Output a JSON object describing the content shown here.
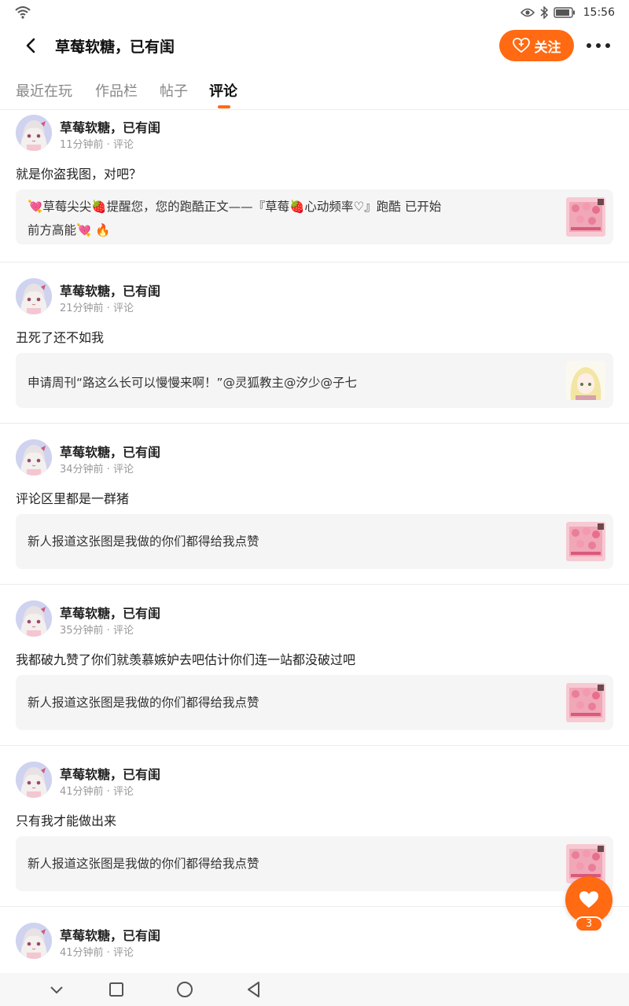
{
  "status": {
    "time": "15:56"
  },
  "header": {
    "title": "草莓软糖，已有闺",
    "follow_label": "关注"
  },
  "tabs": [
    {
      "label": "最近在玩"
    },
    {
      "label": "作品栏"
    },
    {
      "label": "帖子"
    },
    {
      "label": "评论"
    }
  ],
  "active_tab": "评论",
  "comments": [
    {
      "user": "草莓软糖，已有闺",
      "time": "11分钟前 · 评论",
      "text": "就是你盗我图，对吧？",
      "quote_line1": "💘草莓尖尖🍓提醒您，您的跑酷正文——『草莓🍓心动频率♡』跑酷 已开始",
      "quote_line2": "前方高能💘  🔥"
    },
    {
      "user": "草莓软糖，已有闺",
      "time": "21分钟前 · 评论",
      "text": "丑死了还不如我",
      "quote_line1": "申请周刊“路这么长可以慢慢来啊！”@灵狐教主@汐少@子七"
    },
    {
      "user": "草莓软糖，已有闺",
      "time": "34分钟前 · 评论",
      "text": "评论区里都是一群猪",
      "quote_line1": "新人报道这张图是我做的你们都得给我点赞"
    },
    {
      "user": "草莓软糖，已有闺",
      "time": "35分钟前 · 评论",
      "text": "我都破九赞了你们就羡慕嫉妒去吧估计你们连一站都没破过吧",
      "quote_line1": "新人报道这张图是我做的你们都得给我点赞"
    },
    {
      "user": "草莓软糖，已有闺",
      "time": "41分钟前 · 评论",
      "text": "只有我才能做出来",
      "quote_line1": "新人报道这张图是我做的你们都得给我点赞"
    },
    {
      "user": "草莓软糖，已有闺",
      "time": "41分钟前 · 评论"
    }
  ],
  "like": {
    "count": "3"
  },
  "colors": {
    "accent": "#ff6a13"
  },
  "icons": [
    "wifi-icon",
    "eye-icon",
    "bluetooth-icon",
    "battery-icon",
    "back-icon",
    "heart-plus-icon",
    "more-icon",
    "heart-icon",
    "nav-down-icon",
    "nav-square-icon",
    "nav-circle-icon",
    "nav-back-triangle-icon"
  ]
}
